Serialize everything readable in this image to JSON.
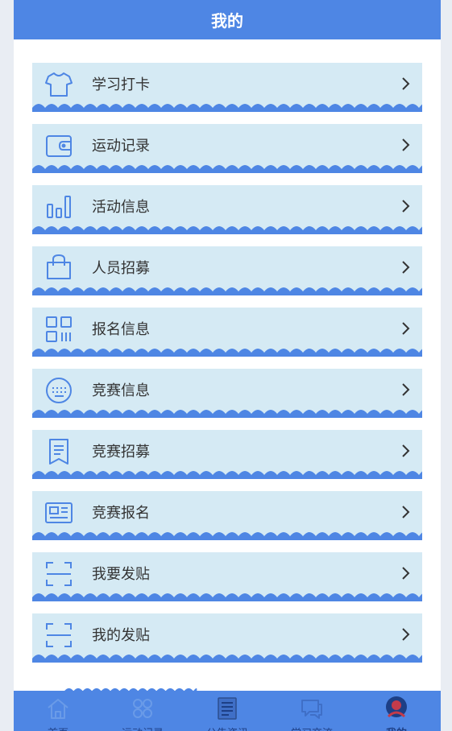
{
  "header": {
    "title": "我的"
  },
  "colors": {
    "accent": "#4e86e4",
    "card": "#d5eaf4",
    "icon": "#4e86e4",
    "tab_icon": "#6a9be8"
  },
  "menu": [
    {
      "label": "学习打卡",
      "icon": "tshirt-icon"
    },
    {
      "label": "运动记录",
      "icon": "wallet-icon"
    },
    {
      "label": "活动信息",
      "icon": "bar-chart-icon"
    },
    {
      "label": "人员招募",
      "icon": "bag-icon"
    },
    {
      "label": "报名信息",
      "icon": "qr-code-icon"
    },
    {
      "label": "竞赛信息",
      "icon": "keyboard-icon"
    },
    {
      "label": "竞赛招募",
      "icon": "bookmark-icon"
    },
    {
      "label": "竞赛报名",
      "icon": "id-card-icon"
    },
    {
      "label": "我要发贴",
      "icon": "scan-icon"
    },
    {
      "label": "我的发贴",
      "icon": "scan-icon"
    }
  ],
  "tabbar": {
    "tabs": [
      {
        "label": "首页",
        "icon": "home-icon"
      },
      {
        "label": "运动记录",
        "icon": "grid-icon"
      },
      {
        "label": "公告资讯",
        "icon": "news-icon"
      },
      {
        "label": "学习交流",
        "icon": "chat-icon"
      },
      {
        "label": "我的",
        "icon": "avatar-icon"
      }
    ],
    "active_index": 4
  }
}
